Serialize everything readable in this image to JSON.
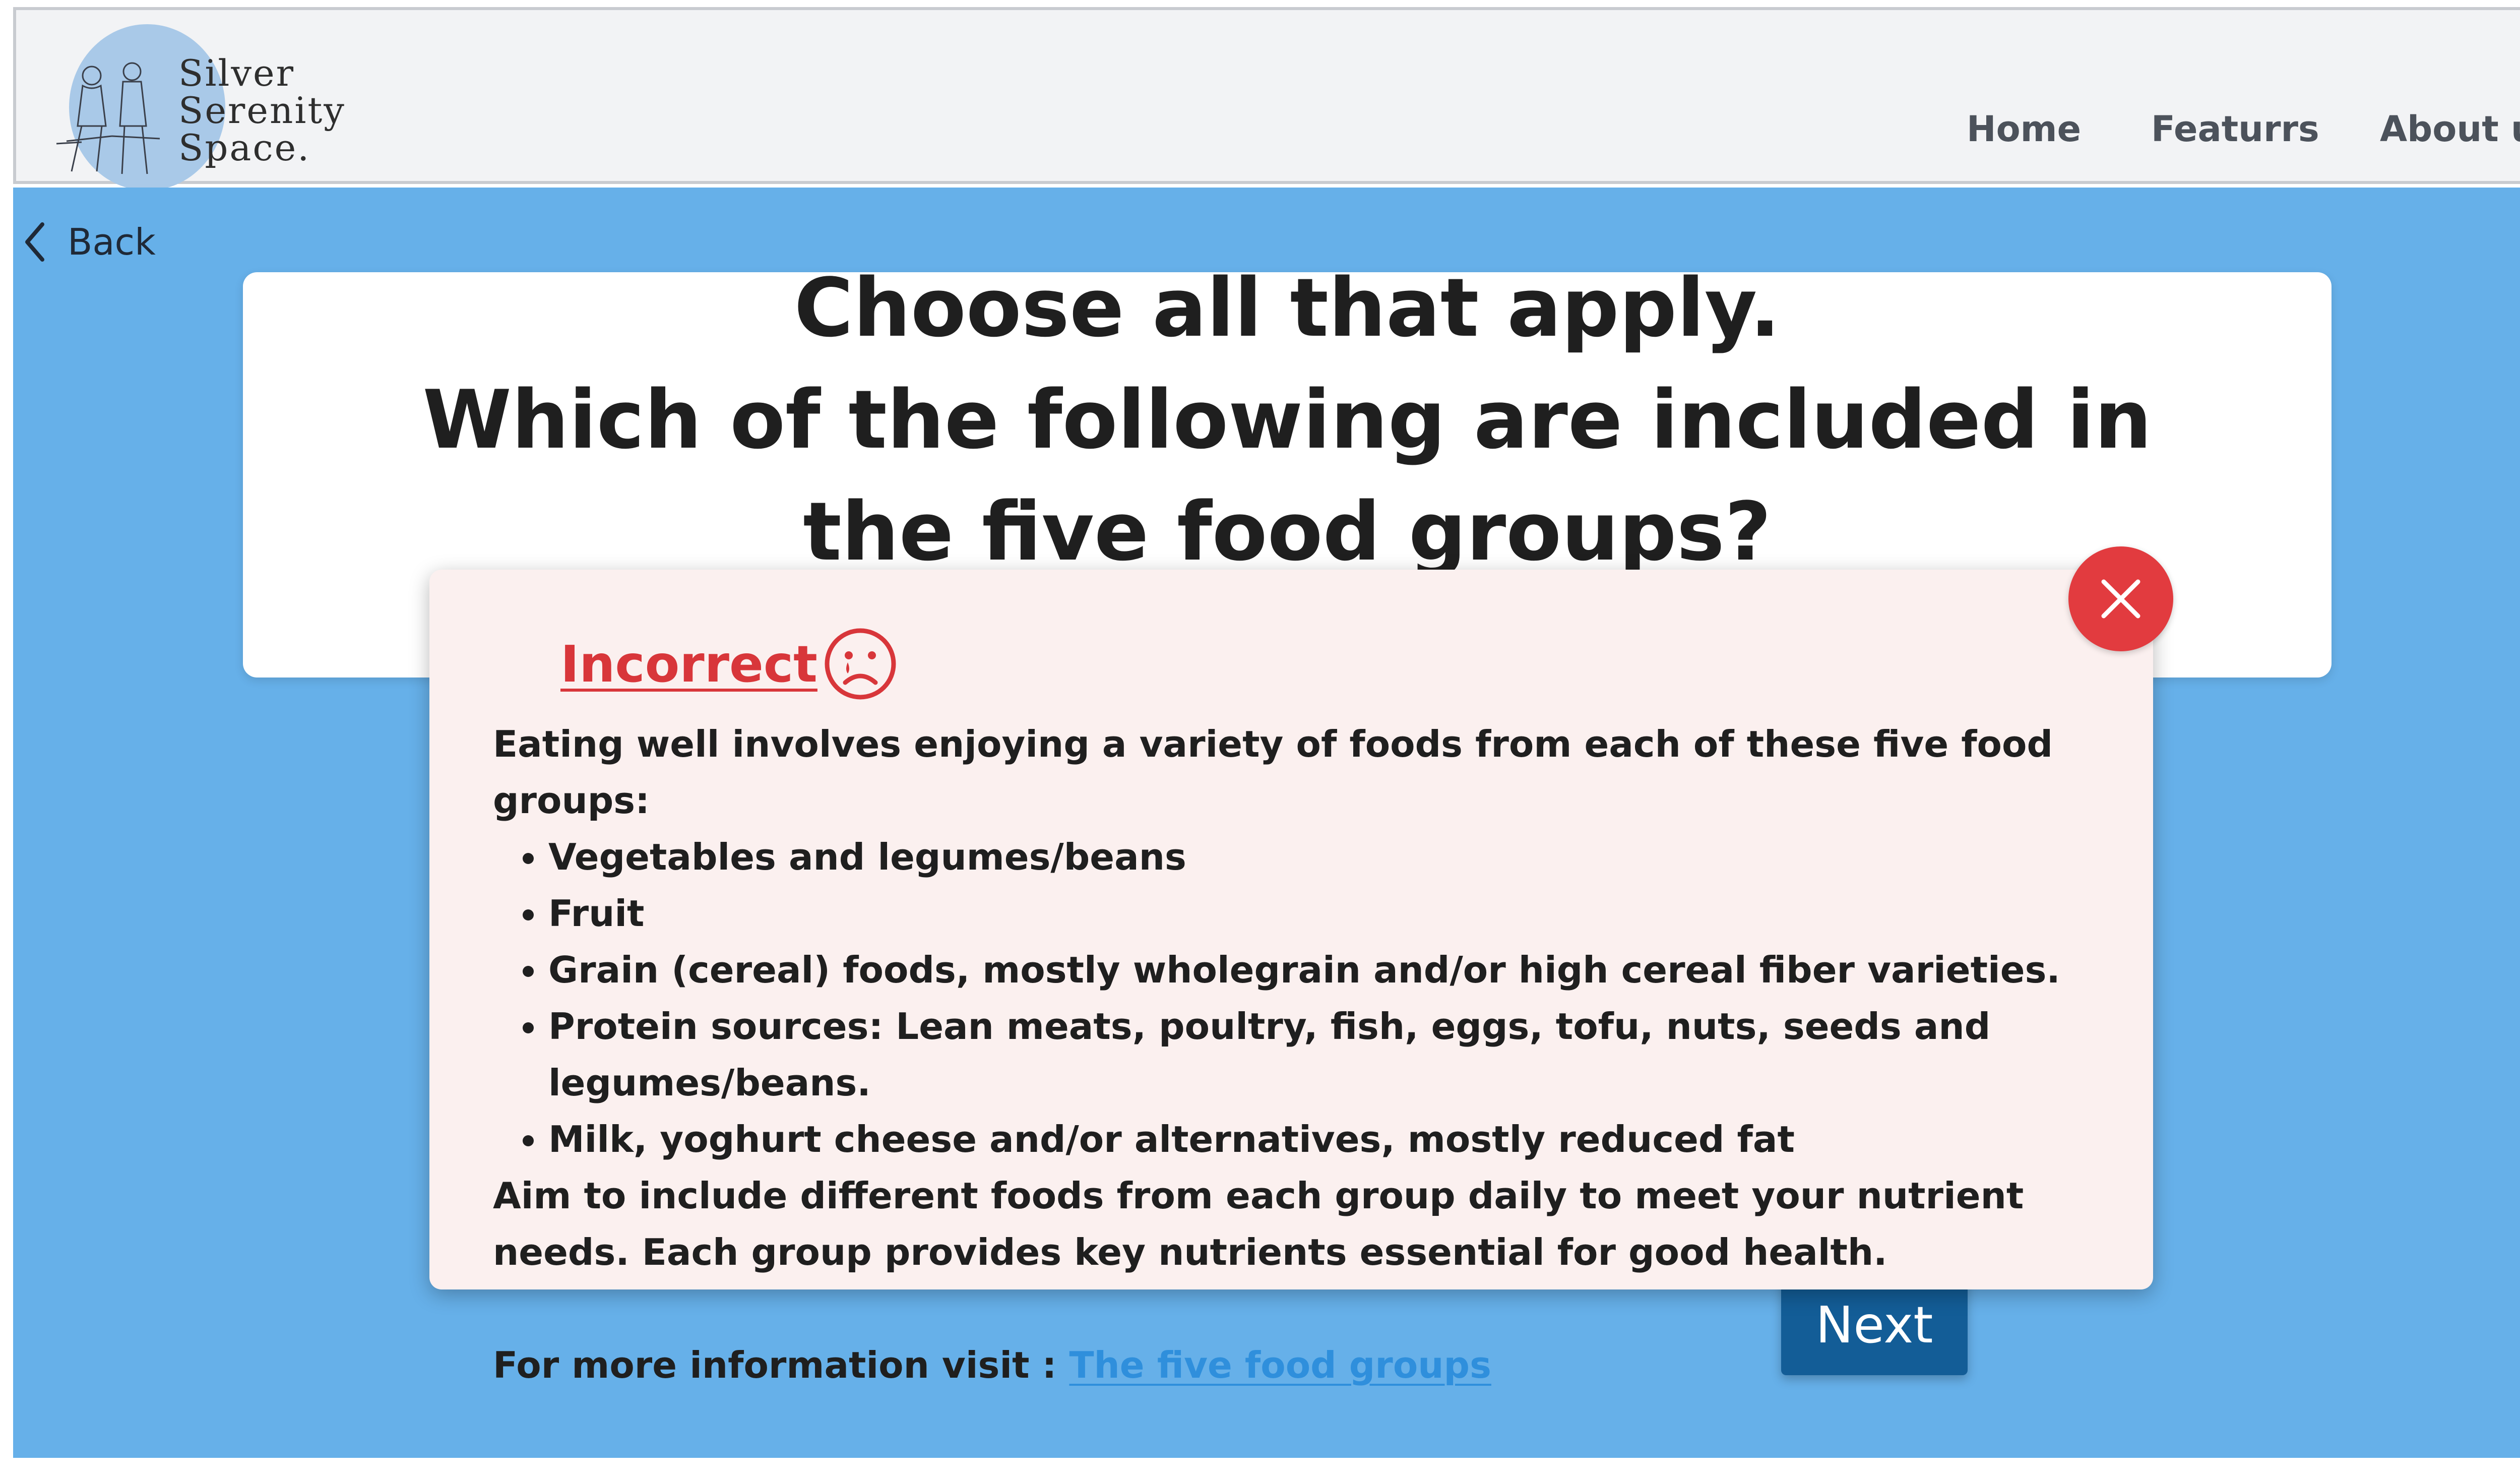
{
  "header": {
    "logo": {
      "line1": "Silver",
      "line2": "Serenity",
      "line3": "Space.",
      "icon": "elderly-couple-logo-icon"
    },
    "nav": [
      {
        "label": "Home"
      },
      {
        "label": "Featurrs"
      },
      {
        "label": "About us"
      }
    ]
  },
  "back": {
    "label": "Back",
    "icon": "chevron-left-icon"
  },
  "question": {
    "instruction": "Choose all that apply.",
    "text": "Which of the following are included in the five food groups?"
  },
  "feedback": {
    "status": "Incorrect",
    "status_icon": "sad-face-icon",
    "intro": "Eating well involves enjoying a variety of foods from each of these five food groups:",
    "groups": [
      "Vegetables and legumes/beans",
      "Fruit",
      "Grain (cereal) foods, mostly wholegrain and/or high cereal fiber varieties.",
      "Protein sources: Lean meats, poultry, fish, eggs, tofu, nuts, seeds and legumes/beans.",
      "Milk, yoghurt cheese and/or alternatives, mostly reduced fat"
    ],
    "advice": "Aim to include different foods from each group daily to meet your nutrient needs. Each group provides key nutrients essential for good health.",
    "more_info_label": "For more information visit :",
    "more_info_link": "The five food groups",
    "close_icon": "close-icon"
  },
  "next_button": {
    "label": "Next"
  },
  "colors": {
    "main_bg": "#66b0e9",
    "header_bg": "#f2f3f5",
    "modal_bg": "#fbf0ef",
    "incorrect": "#d8363a",
    "close_button": "#e23b3f",
    "next_button": "#135d97",
    "link": "#2f8fdc"
  }
}
